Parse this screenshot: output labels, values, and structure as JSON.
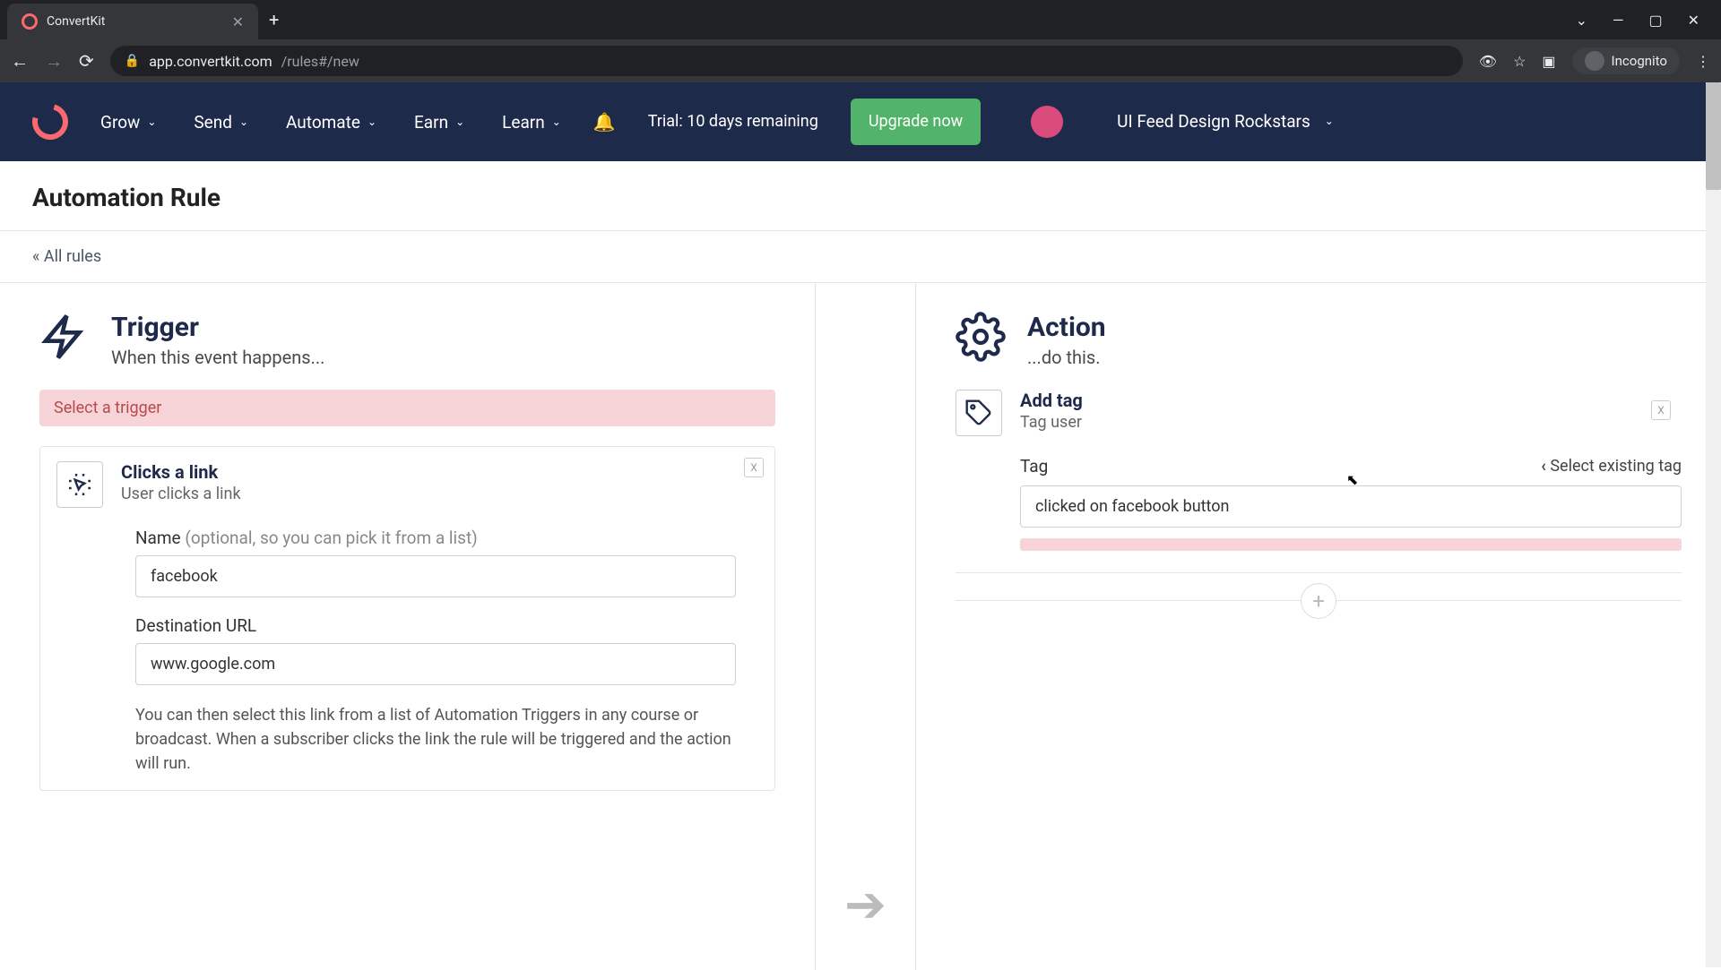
{
  "browser": {
    "tab_title": "ConvertKit",
    "url_domain": "app.convertkit.com",
    "url_path": "/rules#/new",
    "incognito_label": "Incognito"
  },
  "header": {
    "nav": {
      "grow": "Grow",
      "send": "Send",
      "automate": "Automate",
      "learn_nav": "Learn",
      "earn": "Earn"
    },
    "trial": "Trial: 10 days remaining",
    "upgrade": "Upgrade now",
    "workspace": "UI Feed Design Rockstars"
  },
  "page": {
    "title": "Automation Rule",
    "breadcrumb": "« All rules"
  },
  "trigger": {
    "section_title": "Trigger",
    "section_sub": "When this event happens...",
    "error": "Select a trigger",
    "card_title": "Clicks a link",
    "card_sub": "User clicks a link",
    "name_label": "Name",
    "name_hint": "(optional, so you can pick it from a list)",
    "name_value": "facebook",
    "url_label": "Destination URL",
    "url_value": "www.google.com",
    "help": "You can then select this link from a list of Automation Triggers in any course or broadcast. When a subscriber clicks the link the rule will be triggered and the action will run."
  },
  "action": {
    "section_title": "Action",
    "section_sub": "...do this.",
    "card_title": "Add tag",
    "card_sub": "Tag user",
    "tag_label": "Tag",
    "select_link": "Select existing tag",
    "tag_value": "clicked on facebook button"
  }
}
